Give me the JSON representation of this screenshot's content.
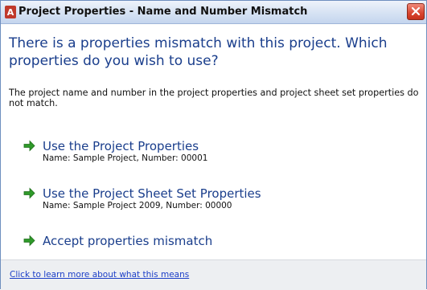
{
  "window": {
    "title": "Project Properties - Name and Number Mismatch"
  },
  "main": {
    "heading": "There is a properties mismatch with this project. Which properties do you wish to use?",
    "description": "The project name and number in the project properties and project sheet set properties do not match."
  },
  "options": [
    {
      "title": "Use the Project Properties",
      "subtitle": "Name: Sample Project, Number: 00001"
    },
    {
      "title": "Use the Project Sheet Set Properties",
      "subtitle": "Name: Sample Project 2009, Number: 00000"
    },
    {
      "title": "Accept properties mismatch"
    }
  ],
  "footer": {
    "link": "Click to learn more about what this means"
  },
  "colors": {
    "heading": "#1a3e8c",
    "arrow": "#2f9a2a",
    "link": "#1c3fc7",
    "close_button": "#d8452f"
  },
  "icons": {
    "app": "autocad-app-icon",
    "close": "close-icon",
    "option": "green-arrow-icon"
  }
}
